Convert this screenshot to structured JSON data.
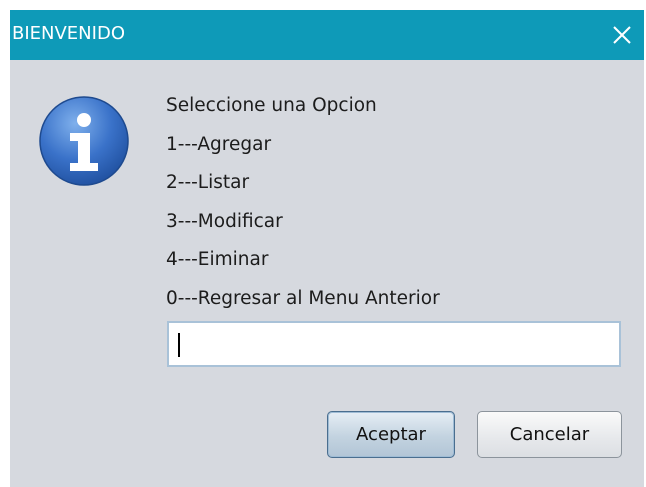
{
  "window": {
    "title": "BIENVENIDO",
    "close_icon": "close-icon",
    "titlebar_color": "#0e9ab8",
    "background_color": "#d6d9df"
  },
  "icon": {
    "name": "info-icon",
    "glyph": "i"
  },
  "message": {
    "lines": [
      "Seleccione una Opcion",
      "1---Agregar",
      "2---Listar",
      "3---Modificar",
      "4---Eiminar",
      "0---Regresar al Menu Anterior"
    ]
  },
  "input": {
    "value": "",
    "placeholder": ""
  },
  "buttons": {
    "accept_label": "Aceptar",
    "cancel_label": "Cancelar"
  }
}
